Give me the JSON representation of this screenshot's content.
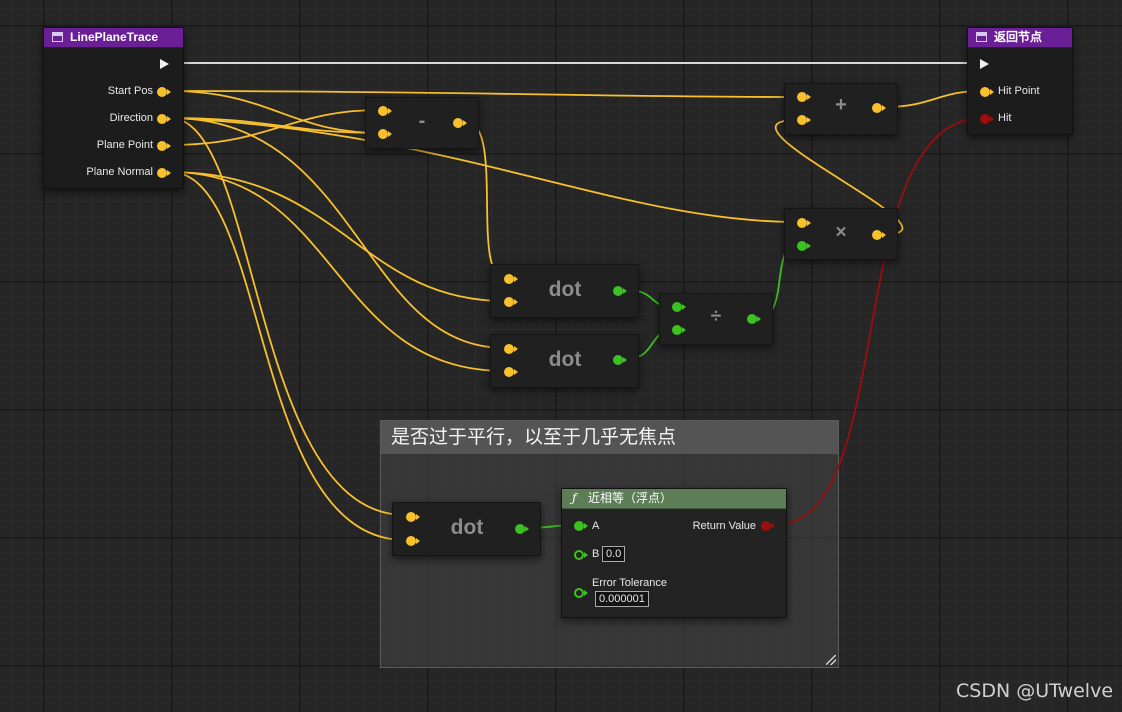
{
  "nodes": {
    "line_plane_trace": {
      "title": "LinePlaneTrace",
      "pins": [
        "Start Pos",
        "Direction",
        "Plane Point",
        "Plane Normal"
      ]
    },
    "return_node": {
      "title": "返回节点",
      "pins": [
        "Hit Point",
        "Hit"
      ]
    },
    "subtract": {
      "op": "-"
    },
    "add": {
      "op": "+"
    },
    "multiply": {
      "op": "×"
    },
    "divide": {
      "op": "÷"
    },
    "dot_1": {
      "label": "dot"
    },
    "dot_2": {
      "label": "dot"
    },
    "dot_3": {
      "label": "dot"
    },
    "nearly_equal": {
      "title": "近相等（浮点）",
      "pin_a": "A",
      "pin_b": "B",
      "b_value": "0.0",
      "tolerance_label": "Error Tolerance",
      "tolerance_value": "0.000001",
      "return_label": "Return Value"
    }
  },
  "comment": {
    "text": "是否过于平行，以至于几乎无焦点"
  },
  "watermark": "CSDN @UTwelve",
  "colors": {
    "vector_wire": "#f7c02c",
    "float_wire": "#3ac320",
    "bool_wire": "#9a0e0e",
    "exec_wire": "#f0f0f0",
    "function_header": "#6b1f97",
    "pure_header": "#5c7d55"
  }
}
